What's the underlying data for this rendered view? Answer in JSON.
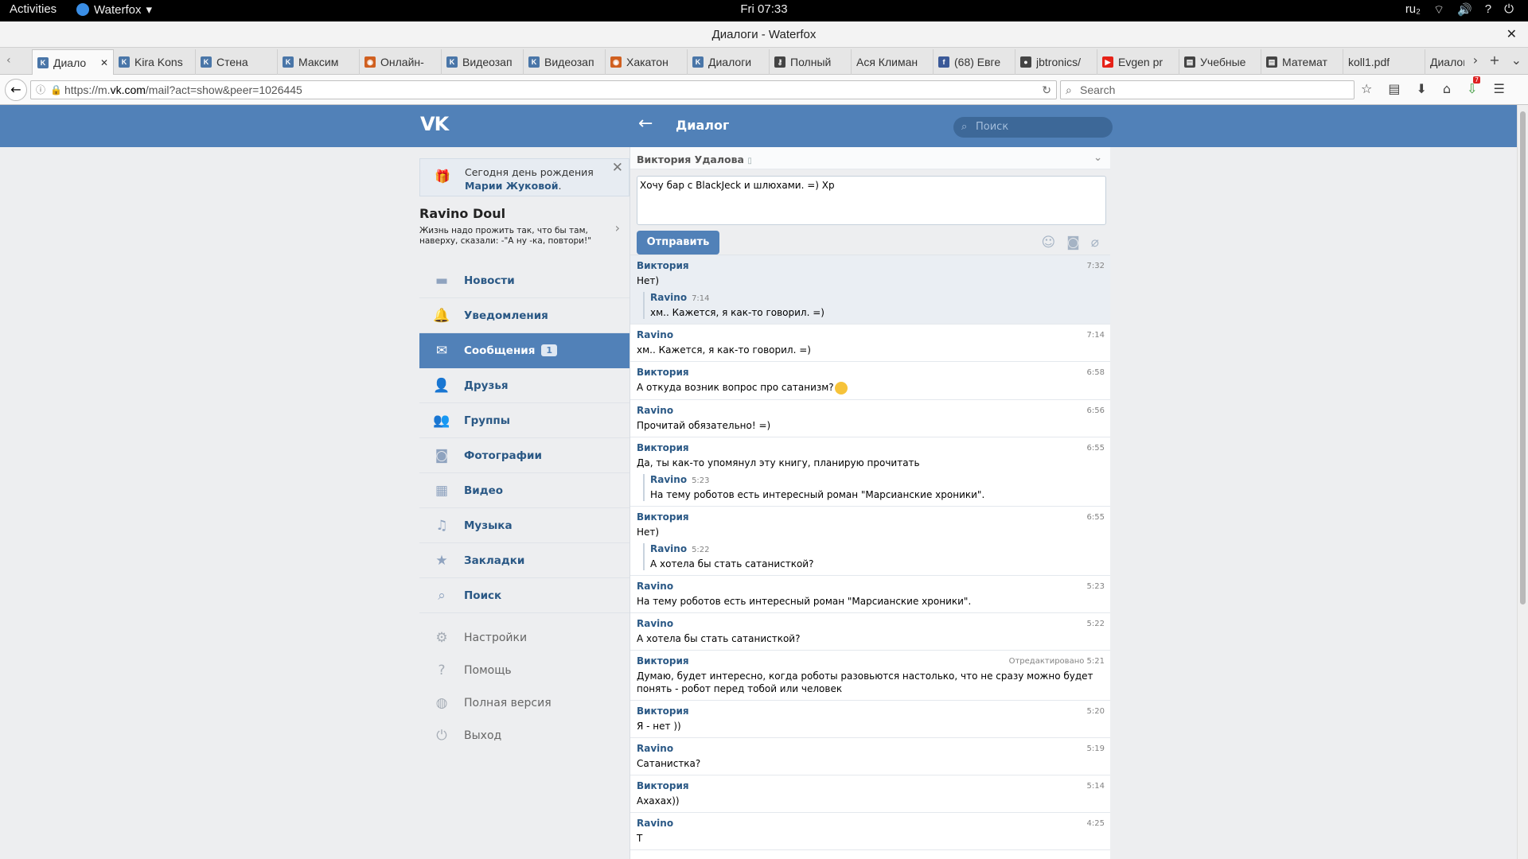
{
  "system": {
    "activities": "Activities",
    "app_name": "Waterfox",
    "clock": "Fri 07:33",
    "lang": "ru₂"
  },
  "window": {
    "title": "Диалоги - Waterfox"
  },
  "tabs": [
    {
      "label": "Диало",
      "fav": "vk"
    },
    {
      "label": "Kira Kons",
      "fav": "vk"
    },
    {
      "label": "Стена",
      "fav": "vk"
    },
    {
      "label": "Максим",
      "fav": "vk"
    },
    {
      "label": "Онлайн-",
      "fav": "web"
    },
    {
      "label": "Видеозап",
      "fav": "vk"
    },
    {
      "label": "Видеозап",
      "fav": "vk"
    },
    {
      "label": "Хакатон",
      "fav": "web"
    },
    {
      "label": "Диалоги",
      "fav": "vk"
    },
    {
      "label": "Полный",
      "fav": "key"
    },
    {
      "label": "Ася Климан",
      "fav": ""
    },
    {
      "label": "(68) Евге",
      "fav": "fb"
    },
    {
      "label": "jbtronics/",
      "fav": "gh"
    },
    {
      "label": "Evgen pr",
      "fav": "yt"
    },
    {
      "label": "Учебные",
      "fav": "doc"
    },
    {
      "label": "Математ",
      "fav": "doc"
    },
    {
      "label": "koll1.pdf",
      "fav": ""
    },
    {
      "label": "Диалоги",
      "fav": ""
    }
  ],
  "urlbar": {
    "url_pre": "https://m.",
    "url_host": "vk.com",
    "url_post": "/mail?act=show&peer=1026445",
    "search_placeholder": "Search",
    "download_badge": "7"
  },
  "vk": {
    "logo": "VK",
    "page_title": "Диалог",
    "search_placeholder": "Поиск"
  },
  "birthday": {
    "text": "Сегодня день рождения",
    "name": "Марии Жуковой",
    "tail": "."
  },
  "profile": {
    "name": "Ravino Doul",
    "status": "Жизнь надо прожить так, что бы там, наверху, сказали: -\"А ну -ка, повтори!\""
  },
  "menu": [
    {
      "label": "Новости",
      "icon": "news-icon"
    },
    {
      "label": "Уведомления",
      "icon": "bell-icon"
    },
    {
      "label": "Сообщения",
      "icon": "mail-icon",
      "badge": "1"
    },
    {
      "label": "Друзья",
      "icon": "person-icon"
    },
    {
      "label": "Группы",
      "icon": "group-icon"
    },
    {
      "label": "Фотографии",
      "icon": "camera-icon"
    },
    {
      "label": "Видео",
      "icon": "film-icon"
    },
    {
      "label": "Музыка",
      "icon": "music-icon"
    },
    {
      "label": "Закладки",
      "icon": "star-icon"
    },
    {
      "label": "Поиск",
      "icon": "search-icon"
    }
  ],
  "menu_secondary": [
    {
      "label": "Настройки",
      "icon": "gear-icon"
    },
    {
      "label": "Помощь",
      "icon": "help-icon"
    },
    {
      "label": "Полная версия",
      "icon": "globe-icon"
    },
    {
      "label": "Выход",
      "icon": "power-icon"
    }
  ],
  "chat": {
    "peer_name": "Виктория Удалова",
    "draft": "Хочу бар с BlackJeck и шлюхами. =) Xp",
    "send_label": "Отправить"
  },
  "messages": [
    {
      "author": "Виктория",
      "time": "7:32",
      "text": "Нет)",
      "unread": true,
      "fwd": {
        "author": "Ravino",
        "time": "7:14",
        "text": "хм.. Кажется, я как-то говорил. =)"
      }
    },
    {
      "author": "Ravino",
      "time": "7:14",
      "text": "хм.. Кажется, я как-то говорил. =)"
    },
    {
      "author": "Виктория",
      "time": "6:58",
      "text": "А откуда возник вопрос про сатанизм?",
      "emoji": true
    },
    {
      "author": "Ravino",
      "time": "6:56",
      "text": "Прочитай обязательно! =)"
    },
    {
      "author": "Виктория",
      "time": "6:55",
      "text": "Да, ты как-то упомянул эту книгу, планирую прочитать",
      "fwd": {
        "author": "Ravino",
        "time": "5:23",
        "text": "На тему роботов есть интересный роман \"Марсианские хроники\"."
      }
    },
    {
      "author": "Виктория",
      "time": "6:55",
      "text": "Нет)",
      "fwd": {
        "author": "Ravino",
        "time": "5:22",
        "text": "А хотела бы стать сатанисткой?"
      }
    },
    {
      "author": "Ravino",
      "time": "5:23",
      "text": "На тему роботов есть интересный роман \"Марсианские хроники\"."
    },
    {
      "author": "Ravino",
      "time": "5:22",
      "text": "А хотела бы стать сатанисткой?"
    },
    {
      "author": "Виктория",
      "time": "Отредактировано 5:21",
      "text": "Думаю, будет интересно, когда роботы разовьются настолько, что не сразу можно будет понять - робот перед тобой или человек"
    },
    {
      "author": "Виктория",
      "time": "5:20",
      "text": "Я - нет ))"
    },
    {
      "author": "Ravino",
      "time": "5:19",
      "text": "Сатанистка?"
    },
    {
      "author": "Виктория",
      "time": "5:14",
      "text": "Ахахах))"
    },
    {
      "author": "Ravino",
      "time": "4:25",
      "text": "Т"
    }
  ]
}
